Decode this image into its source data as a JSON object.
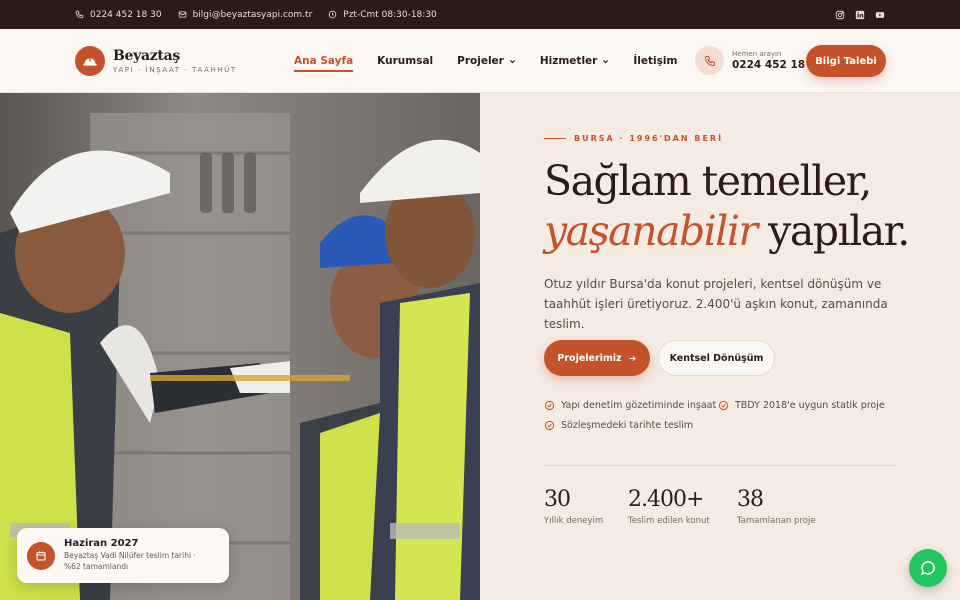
{
  "topbar": {
    "phone": "0224 452 18 30",
    "email": "bilgi@beyaztasyapi.com.tr",
    "hours": "Pzt-Cmt 08:30-18:30",
    "socials": [
      "instagram-icon",
      "linkedin-icon",
      "youtube-icon"
    ]
  },
  "brand": {
    "name": "Beyaztaş",
    "tagline": "YAPI · İNŞAAT · TAAHHÜT",
    "accent_color": "#c4522b",
    "dark_color": "#2a1c14"
  },
  "nav": {
    "items": [
      {
        "label": "Ana Sayfa",
        "active": true
      },
      {
        "label": "Kurumsal"
      },
      {
        "label": "Projeler",
        "dropdown": true
      },
      {
        "label": "Hizmetler",
        "dropdown": true
      },
      {
        "label": "İletişim"
      }
    ]
  },
  "call": {
    "label": "Hemen arayın",
    "number": "0224 452 18 30"
  },
  "cta": {
    "label": "Bilgi Talebi"
  },
  "hero": {
    "eyebrow": "BURSA · 1996'DAN BERİ",
    "title_line1": "Sağlam temeller,",
    "title_accent": "yaşanabilir",
    "title_rest": " yapılar.",
    "lead": "Otuz yıldır Bursa'da konut projeleri, kentsel dönüşüm ve taahhüt işleri üretiyoruz. 2.400'ü aşkın konut, zamanında teslim.",
    "primary_button": "Projelerimiz",
    "secondary_button": "Kentsel Dönüşüm",
    "checks": [
      "Yapı denetim gözetiminde inşaat",
      "TBDY 2018'e uygun statik proje",
      "Sözleşmedeki tarihte teslim"
    ],
    "stats": [
      {
        "value": "30",
        "label": "Yıllık deneyim"
      },
      {
        "value": "2.400+",
        "label": "Teslim edilen konut"
      },
      {
        "value": "38",
        "label": "Tamamlanan proje"
      }
    ]
  },
  "toast": {
    "title": "Haziran 2027",
    "text_line1": "Beyaztaş Vadi Nilüfer teslim tarihi ·",
    "text_line2": "%62 tamamlandı"
  },
  "whatsapp": {
    "icon": "whatsapp-icon",
    "color": "#22c55e"
  }
}
